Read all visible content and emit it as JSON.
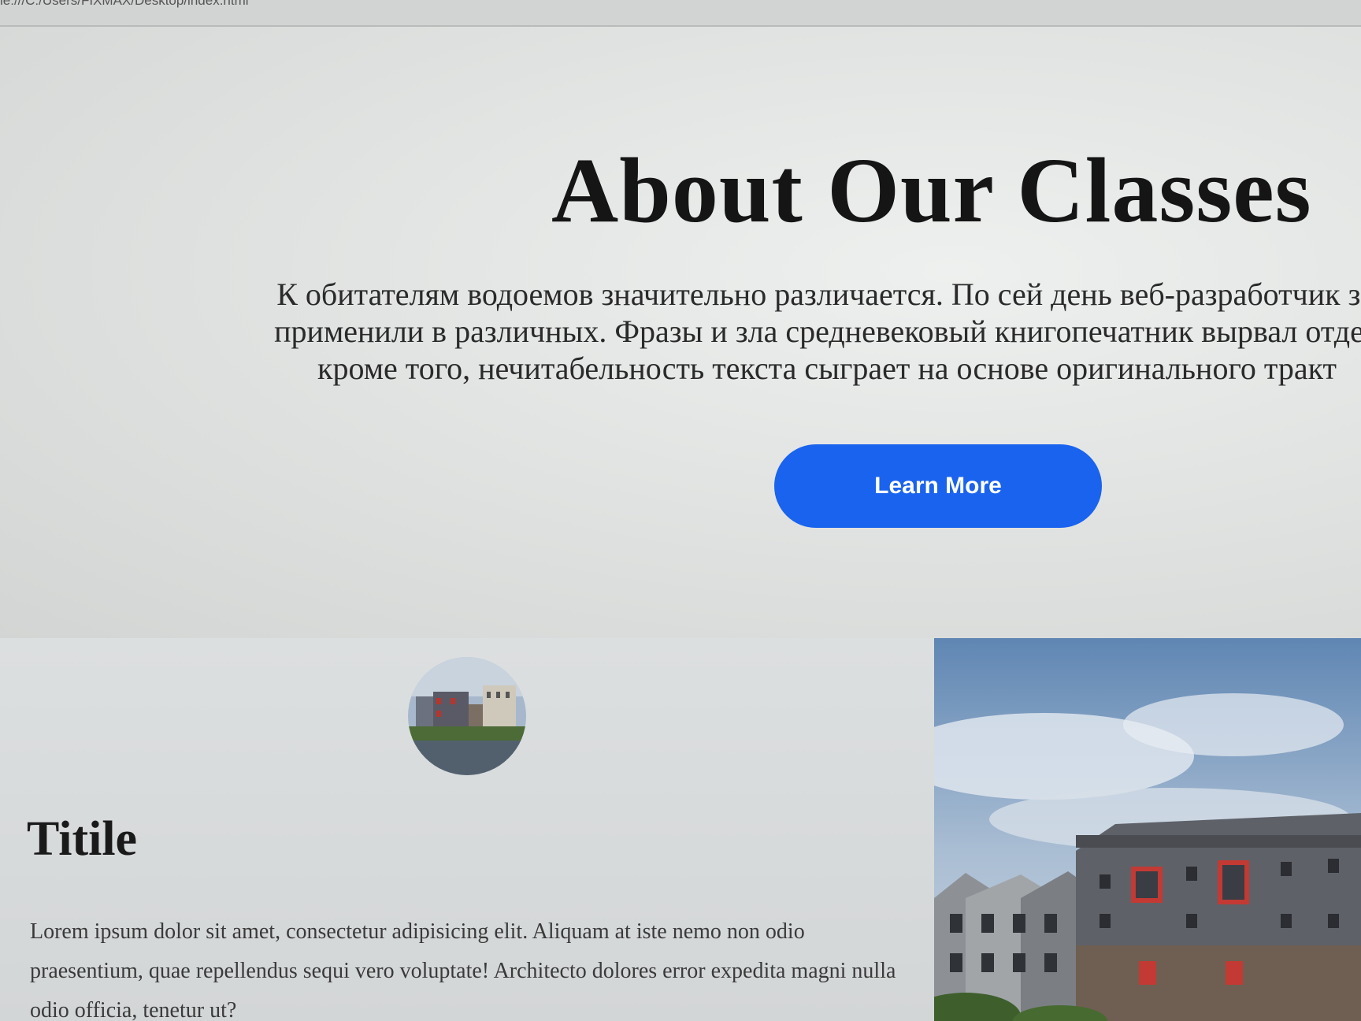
{
  "browser": {
    "url": "le:///C:/Users/FIXMAX/Desktop/index.html"
  },
  "hero": {
    "title": "About Our Classes",
    "lines": [
      "К обитателям водоемов значительно различается. По сей день веб-разработчик зн",
      "применили в различных. Фразы и зла средневековый книгопечатник вырвал отдел",
      "кроме того, нечитабельность текста сыграет на основе оригинального тракт"
    ],
    "button_label": "Learn More",
    "button_color": "#1a63ee"
  },
  "feature": {
    "title": "Titile",
    "body": "Lorem ipsum dolor sit amet, consectetur adipisicing elit. Aliquam at iste nemo non odio praesentium, quae repellendus sequi vero voluptate! Architecto dolores error expedita magni nulla odio officia, tenetur ut?"
  }
}
